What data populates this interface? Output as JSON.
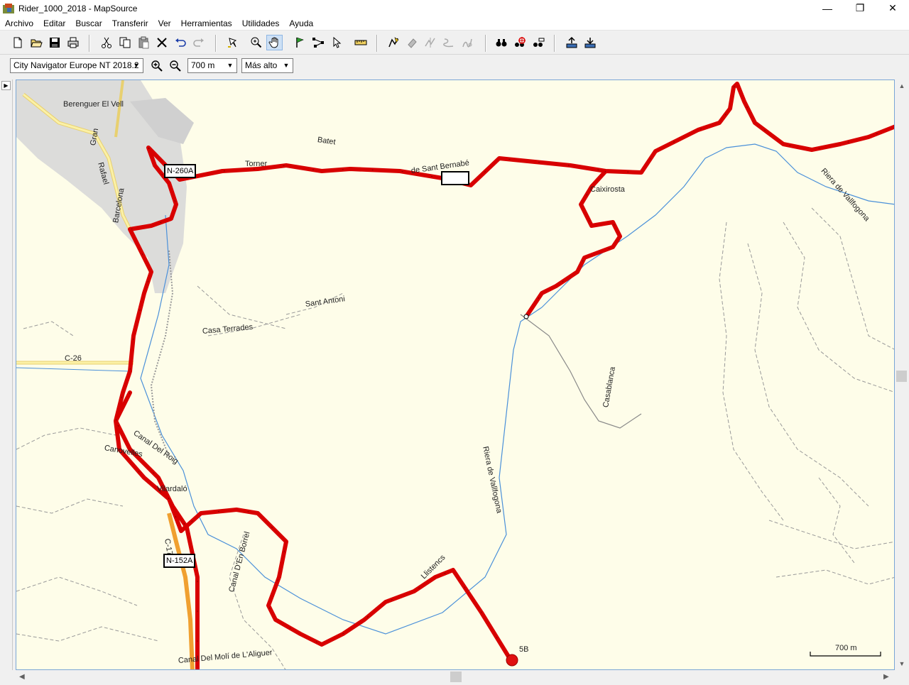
{
  "window": {
    "title": "Rider_1000_2018 - MapSource",
    "minimize": "—",
    "restore": "❐",
    "close": "✕"
  },
  "menu": [
    "Archivo",
    "Editar",
    "Buscar",
    "Transferir",
    "Ver",
    "Herramientas",
    "Utilidades",
    "Ayuda"
  ],
  "toolbar": {
    "icons": [
      "new-icon",
      "open-icon",
      "save-icon",
      "print-icon",
      "cut-icon",
      "copy-icon",
      "paste-icon",
      "delete-icon",
      "undo-icon",
      "redo-icon",
      "select-map-icon",
      "zoom-tool-icon",
      "hand-tool-icon",
      "waypoint-tool-icon",
      "route-tool-icon",
      "selection-tool-icon",
      "distance-tool-icon",
      "track-tool-icon",
      "eraser-tool-icon",
      "divide-track-icon",
      "join-track-icon",
      "split-track-icon",
      "find-icon",
      "find-near-icon",
      "find-address-icon",
      "receive-from-device-icon",
      "send-to-device-icon"
    ],
    "pressed_icon": "hand-tool-icon"
  },
  "toolbar2": {
    "map_product": "City Navigator Europe NT 2018.2",
    "zoom_in": "zoom-in-icon",
    "zoom_out": "zoom-out-icon",
    "scale": "700 m",
    "detail": "Más alto"
  },
  "map": {
    "labels": {
      "berenguer": "Berenguer El Vell",
      "batet": "Batet",
      "torner": "Torner",
      "sant_bernabe": "de Sant Bernabé",
      "caixirosta": "Caixirosta",
      "riera_top": "Riera de Vallfogona",
      "sant_antoni": "Sant Antoni",
      "casa_terrades": "Casa Terrades",
      "c26": "C-26",
      "casablanca": "Casablanca",
      "canal_roig": "Canal Del Roig",
      "canovelles": "Canovelles",
      "riera_mid": "Riera de Vallfogona",
      "vilarda": "Vilardaló",
      "c17": "C-17",
      "canal_borrel": "Canal D'En Borrel",
      "llistencs": "Llistencs",
      "canal_moli": "Canal Del Molí de L'Aliguer",
      "barcelona": "Barcelona",
      "rafael": "Rafael",
      "gran": "Gran"
    },
    "shields": {
      "n260a": "N-260A",
      "n152a": "N-152A"
    },
    "waypoint": "5B",
    "scale_bar": "700 m",
    "colors": {
      "background": "#fefde9",
      "track": "#e00000",
      "road_major": "#f2e07a",
      "road_orange": "#f0a030",
      "river": "#4a90d9",
      "urban": "#d8d8d8"
    }
  },
  "scrollbars": {
    "up": "▲",
    "down": "▼",
    "left": "◀",
    "right": "▶"
  }
}
